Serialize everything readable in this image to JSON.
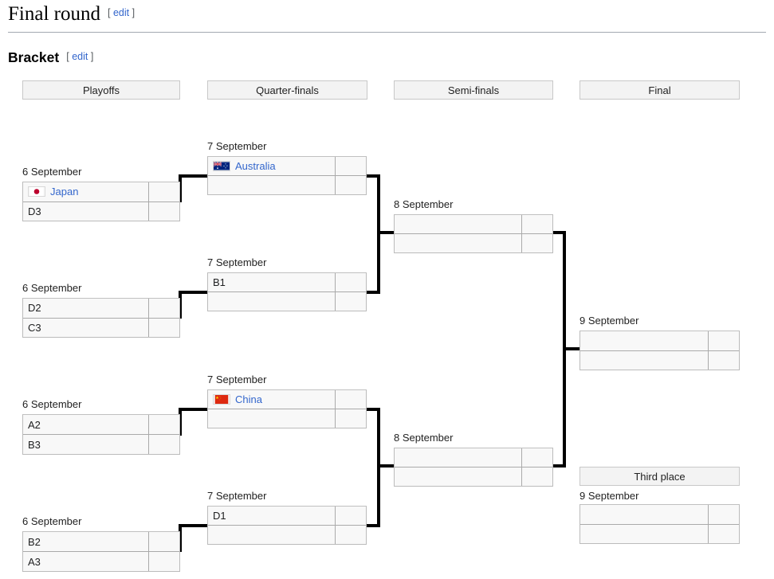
{
  "page": {
    "title": "Final round",
    "edit_label": "edit",
    "bracket_heading": "Bracket"
  },
  "rounds": [
    {
      "id": "playoffs",
      "label": "Playoffs"
    },
    {
      "id": "quarter-finals",
      "label": "Quarter-finals"
    },
    {
      "id": "semi-finals",
      "label": "Semi-finals"
    },
    {
      "id": "final",
      "label": "Final"
    }
  ],
  "third_place": {
    "label": "Third place"
  },
  "matches": {
    "po1": {
      "date": "6 September",
      "team1": "Japan",
      "team1_flag": "japan-flag",
      "score1": "",
      "team2": "D3",
      "team2_flag": "",
      "score2": ""
    },
    "po2": {
      "date": "6 September",
      "team1": "D2",
      "team1_flag": "",
      "score1": "",
      "team2": "C3",
      "team2_flag": "",
      "score2": ""
    },
    "po3": {
      "date": "6 September",
      "team1": "A2",
      "team1_flag": "",
      "score1": "",
      "team2": "B3",
      "team2_flag": "",
      "score2": ""
    },
    "po4": {
      "date": "6 September",
      "team1": "B2",
      "team1_flag": "",
      "score1": "",
      "team2": "A3",
      "team2_flag": "",
      "score2": ""
    },
    "qf1": {
      "date": "7 September",
      "team1": "Australia",
      "team1_flag": "australia-flag",
      "score1": "",
      "team2": "",
      "team2_flag": "",
      "score2": ""
    },
    "qf2": {
      "date": "7 September",
      "team1": "B1",
      "team1_flag": "",
      "score1": "",
      "team2": "",
      "team2_flag": "",
      "score2": ""
    },
    "qf3": {
      "date": "7 September",
      "team1": "China",
      "team1_flag": "china-flag",
      "score1": "",
      "team2": "",
      "team2_flag": "",
      "score2": ""
    },
    "qf4": {
      "date": "7 September",
      "team1": "D1",
      "team1_flag": "",
      "score1": "",
      "team2": "",
      "team2_flag": "",
      "score2": ""
    },
    "sf1": {
      "date": "8 September",
      "team1": "",
      "team1_flag": "",
      "score1": "",
      "team2": "",
      "team2_flag": "",
      "score2": ""
    },
    "sf2": {
      "date": "8 September",
      "team1": "",
      "team1_flag": "",
      "score1": "",
      "team2": "",
      "team2_flag": "",
      "score2": ""
    },
    "final": {
      "date": "9 September",
      "team1": "",
      "team1_flag": "",
      "score1": "",
      "team2": "",
      "team2_flag": "",
      "score2": ""
    },
    "third": {
      "date": "9 September",
      "team1": "",
      "team1_flag": "",
      "score1": "",
      "team2": "",
      "team2_flag": "",
      "score2": ""
    }
  },
  "colors": {
    "link": "#3366cc",
    "box_bg": "#f8f8f8",
    "box_border": "#bbbbbb",
    "header_bg": "#f3f3f3",
    "line": "#000000"
  }
}
